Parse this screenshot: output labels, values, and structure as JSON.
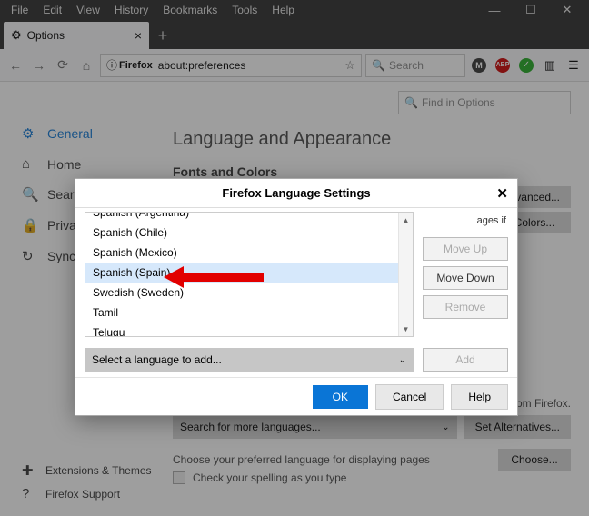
{
  "menubar": [
    "File",
    "Edit",
    "View",
    "History",
    "Bookmarks",
    "Tools",
    "Help"
  ],
  "tab": {
    "title": "Options"
  },
  "url": {
    "brand": "Firefox",
    "value": "about:preferences"
  },
  "searchbar_placeholder": "Search",
  "sidebar": {
    "items": [
      {
        "icon": "⚙",
        "label": "General",
        "sel": true
      },
      {
        "icon": "⌂",
        "label": "Home"
      },
      {
        "icon": "🔍",
        "label": "Search"
      },
      {
        "icon": "🔒",
        "label": "Privacy & Security"
      },
      {
        "icon": "↻",
        "label": "Sync"
      }
    ],
    "footer": [
      {
        "icon": "✚",
        "label": "Extensions & Themes"
      },
      {
        "icon": "?",
        "label": "Firefox Support"
      }
    ]
  },
  "content": {
    "find_placeholder": "Find in Options",
    "heading": "Language and Appearance",
    "fonts_heading": "Fonts and Colors",
    "advanced_btn": "Advanced...",
    "colors_btn": "Colors...",
    "pages_if": "ages if",
    "lang_from": "s from Firefox.",
    "search_more": "Search for more languages...",
    "set_alt": "Set Alternatives...",
    "pref_lang": "Choose your preferred language for displaying pages",
    "choose": "Choose...",
    "spellcheck": "Check your spelling as you type"
  },
  "dialog": {
    "title": "Firefox Language Settings",
    "list": [
      "Spanish (Argentina)",
      "Spanish (Chile)",
      "Spanish (Mexico)",
      "Spanish (Spain)",
      "Swedish (Sweden)",
      "Tamil",
      "Telugu"
    ],
    "selected_index": 3,
    "moveup": "Move Up",
    "movedown": "Move Down",
    "remove": "Remove",
    "add": "Add",
    "add_lang_placeholder": "Select a language to add...",
    "ok": "OK",
    "cancel": "Cancel",
    "help": "Help"
  }
}
